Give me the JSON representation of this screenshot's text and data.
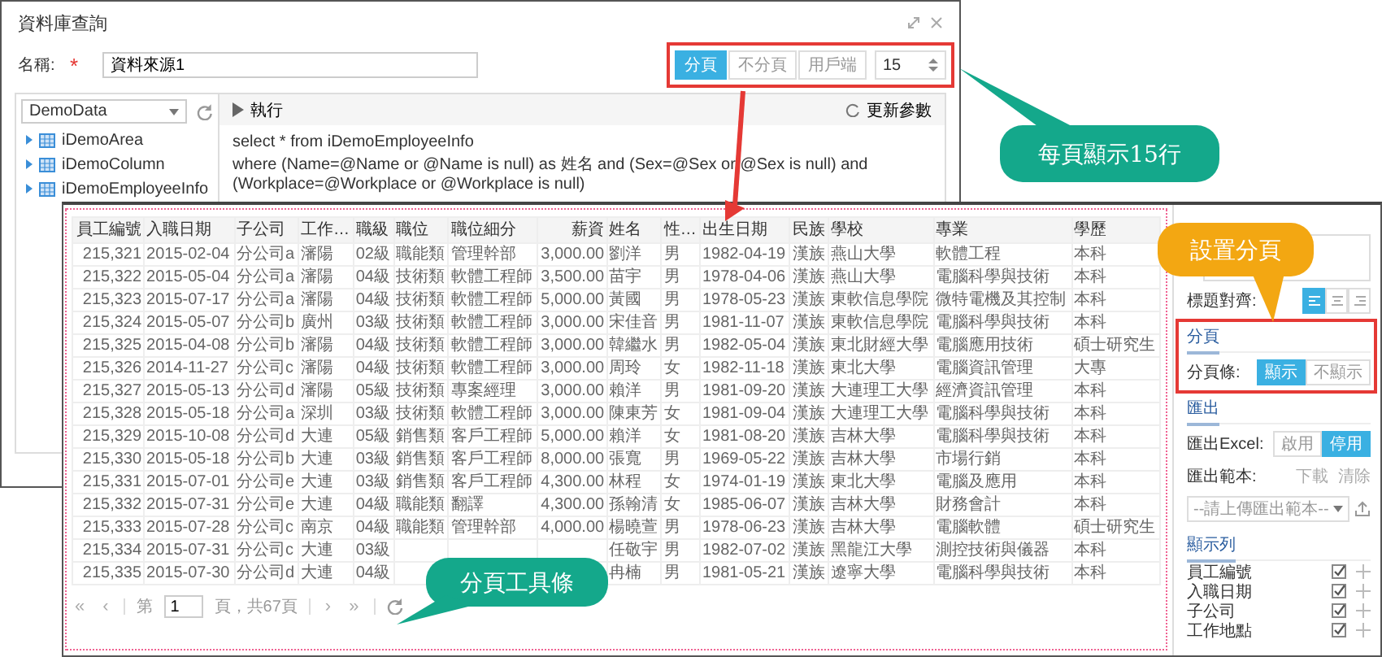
{
  "query_window": {
    "title": "資料庫查詢",
    "name_label": "名稱:",
    "required_mark": "*",
    "name_value": "資料來源1",
    "paging_modes": [
      {
        "label": "分頁",
        "selected": true
      },
      {
        "label": "不分頁",
        "selected": false
      },
      {
        "label": "用戶端",
        "selected": false
      }
    ],
    "page_size": "15",
    "datasource": "DemoData",
    "tables": [
      {
        "label": "iDemoArea"
      },
      {
        "label": "iDemoColumn"
      },
      {
        "label": "iDemoEmployeeInfo"
      }
    ],
    "run_label": "執行",
    "refresh_label": "更新參數",
    "sql_lines": [
      "select * from iDemoEmployeeInfo",
      "where (Name=@Name or @Name is null) as 姓名 and (Sex=@Sex or @Sex is null) and (Workplace=@Workplace or @Workplace is null)"
    ]
  },
  "report": {
    "columns": [
      {
        "label": "員工編號",
        "kind": "number"
      },
      {
        "label": "入職日期",
        "kind": "text"
      },
      {
        "label": "子公司",
        "kind": "text"
      },
      {
        "label": "工作…",
        "kind": "text"
      },
      {
        "label": "職級",
        "kind": "text"
      },
      {
        "label": "職位",
        "kind": "text"
      },
      {
        "label": "職位細分",
        "kind": "text"
      },
      {
        "label": "薪資",
        "kind": "number"
      },
      {
        "label": "姓名",
        "kind": "text"
      },
      {
        "label": "性…",
        "kind": "text"
      },
      {
        "label": "出生日期",
        "kind": "text"
      },
      {
        "label": "民族",
        "kind": "text"
      },
      {
        "label": "學校",
        "kind": "text"
      },
      {
        "label": "專業",
        "kind": "text"
      },
      {
        "label": "學歷",
        "kind": "text"
      }
    ],
    "rows": [
      [
        "215,321",
        "2015-02-04",
        "分公司a",
        "瀋陽",
        "02級",
        "職能類",
        "管理幹部",
        "3,000.00",
        "劉洋",
        "男",
        "1982-04-19",
        "漢族",
        "燕山大學",
        "軟體工程",
        "本科"
      ],
      [
        "215,322",
        "2015-05-04",
        "分公司a",
        "瀋陽",
        "04級",
        "技術類",
        "軟體工程師",
        "3,500.00",
        "苗宇",
        "男",
        "1978-04-06",
        "漢族",
        "燕山大學",
        "電腦科學與技術",
        "本科"
      ],
      [
        "215,323",
        "2015-07-17",
        "分公司a",
        "瀋陽",
        "04級",
        "技術類",
        "軟體工程師",
        "5,000.00",
        "黃國",
        "男",
        "1978-05-23",
        "漢族",
        "東軟信息學院",
        "微特電機及其控制",
        "本科"
      ],
      [
        "215,324",
        "2015-05-07",
        "分公司b",
        "廣州",
        "03級",
        "技術類",
        "軟體工程師",
        "3,000.00",
        "宋佳音",
        "男",
        "1981-11-07",
        "漢族",
        "東軟信息學院",
        "電腦科學與技術",
        "本科"
      ],
      [
        "215,325",
        "2015-04-08",
        "分公司b",
        "瀋陽",
        "04級",
        "技術類",
        "軟體工程師",
        "3,000.00",
        "韓繼水",
        "男",
        "1982-05-04",
        "漢族",
        "東北財經大學",
        "電腦應用技術",
        "碩士研究生"
      ],
      [
        "215,326",
        "2014-11-27",
        "分公司c",
        "瀋陽",
        "04級",
        "技術類",
        "軟體工程師",
        "3,000.00",
        "周玲",
        "女",
        "1982-11-18",
        "漢族",
        "東北大學",
        "電腦資訊管理",
        "大專"
      ],
      [
        "215,327",
        "2015-05-13",
        "分公司d",
        "瀋陽",
        "05級",
        "技術類",
        "專案經理",
        "3,000.00",
        "賴洋",
        "男",
        "1981-09-20",
        "漢族",
        "大連理工大學",
        "經濟資訊管理",
        "本科"
      ],
      [
        "215,328",
        "2015-05-18",
        "分公司a",
        "深圳",
        "03級",
        "技術類",
        "軟體工程師",
        "3,000.00",
        "陳東芳",
        "女",
        "1981-09-04",
        "漢族",
        "大連理工大學",
        "電腦科學與技術",
        "本科"
      ],
      [
        "215,329",
        "2015-10-08",
        "分公司d",
        "大連",
        "05級",
        "銷售類",
        "客戶工程師",
        "5,000.00",
        "賴洋",
        "女",
        "1981-08-20",
        "漢族",
        "吉林大學",
        "電腦科學與技術",
        "本科"
      ],
      [
        "215,330",
        "2015-05-18",
        "分公司b",
        "大連",
        "03級",
        "銷售類",
        "客戶工程師",
        "8,000.00",
        "張寬",
        "男",
        "1969-05-22",
        "漢族",
        "吉林大學",
        "市場行銷",
        "本科"
      ],
      [
        "215,331",
        "2015-07-01",
        "分公司e",
        "大連",
        "03級",
        "銷售類",
        "客戶工程師",
        "4,300.00",
        "林程",
        "女",
        "1974-01-19",
        "漢族",
        "東北大學",
        "電腦及應用",
        "本科"
      ],
      [
        "215,332",
        "2015-07-31",
        "分公司e",
        "大連",
        "04級",
        "職能類",
        "翻譯",
        "4,300.00",
        "孫翰清",
        "女",
        "1985-06-07",
        "漢族",
        "吉林大學",
        "財務會計",
        "本科"
      ],
      [
        "215,333",
        "2015-07-28",
        "分公司c",
        "南京",
        "04級",
        "職能類",
        "管理幹部",
        "4,000.00",
        "楊曉萱",
        "男",
        "1978-06-23",
        "漢族",
        "吉林大學",
        "電腦軟體",
        "碩士研究生"
      ],
      [
        "215,334",
        "2015-07-31",
        "分公司c",
        "大連",
        "03級",
        null,
        null,
        null,
        "任敬宇",
        "男",
        "1982-07-02",
        "漢族",
        "黑龍江大學",
        "測控技術與儀器",
        "本科"
      ],
      [
        "215,335",
        "2015-07-30",
        "分公司d",
        "大連",
        "04級",
        null,
        null,
        null,
        "冉楠",
        "男",
        "1981-05-21",
        "漢族",
        "遼寧大學",
        "電腦科學與技術",
        "本科"
      ]
    ],
    "pager": {
      "first": "«",
      "prev": "‹",
      "page_prefix": "第",
      "page": "1",
      "page_suffix": "頁，共67頁",
      "next": "›",
      "last": "»"
    }
  },
  "settings": {
    "title_align": {
      "label": "標題對齊:",
      "options": [
        {
          "selected": true
        },
        {
          "selected": false
        },
        {
          "selected": false
        }
      ]
    },
    "paging": {
      "heading": "分頁",
      "label": "分頁條:",
      "options": [
        {
          "label": "顯示",
          "selected": true
        },
        {
          "label": "不顯示",
          "selected": false
        }
      ]
    },
    "export": {
      "heading": "匯出",
      "excel_label": "匯出Excel:",
      "options": [
        {
          "label": "啟用",
          "selected": false
        },
        {
          "label": "停用",
          "selected": true
        }
      ],
      "template_label": "匯出範本:",
      "download": "下載",
      "clear": "清除",
      "template_placeholder": "--請上傳匯出範本--"
    },
    "columns": {
      "heading": "顯示列",
      "items": [
        {
          "label": "員工編號",
          "checked": true
        },
        {
          "label": "入職日期",
          "checked": true
        },
        {
          "label": "子公司",
          "checked": true
        },
        {
          "label": "工作地點",
          "checked": true
        }
      ]
    }
  },
  "callouts": [
    {
      "text": "每頁顯示15行",
      "color": "#14a88b"
    },
    {
      "text": "設置分頁",
      "color": "#f3a712"
    },
    {
      "text": "分頁工具條",
      "color": "#14a88b"
    }
  ]
}
